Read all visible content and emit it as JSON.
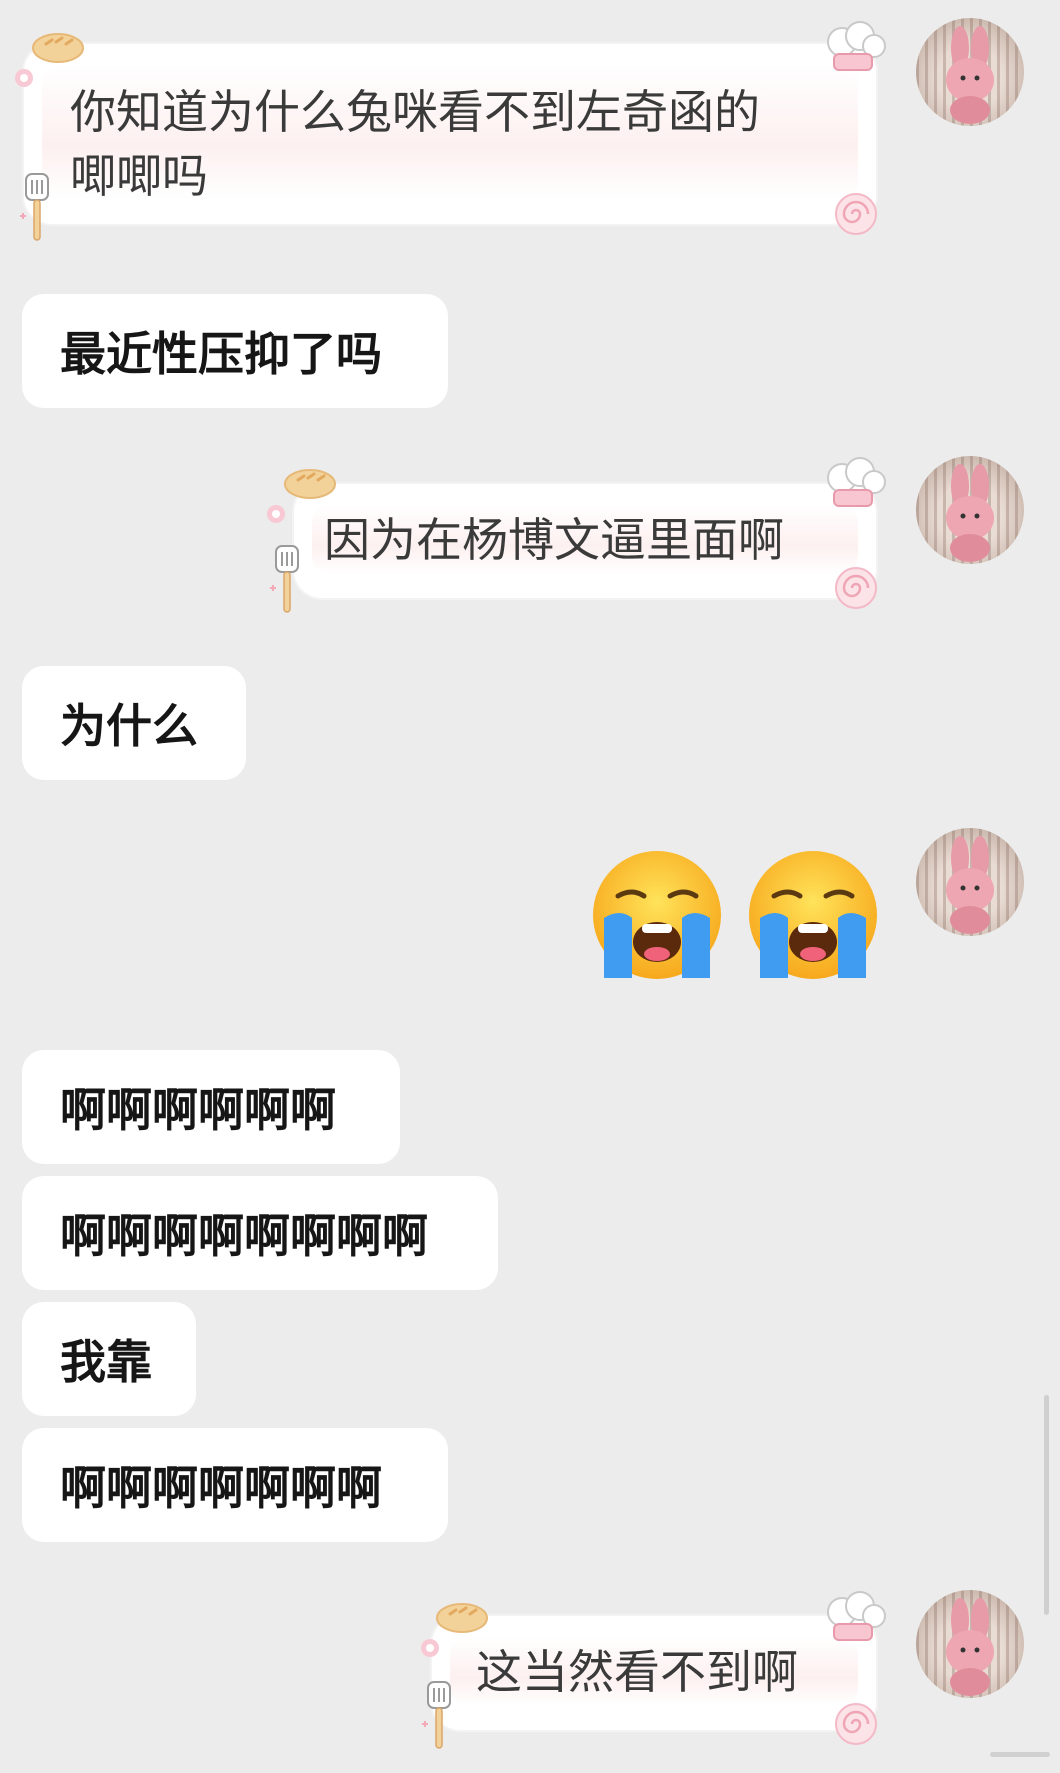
{
  "messages": [
    {
      "side": "right",
      "text_line1": "你知道为什么兔咪看不到左奇函的",
      "text_line2": "唧唧吗"
    },
    {
      "side": "left",
      "text": "最近性压抑了吗"
    },
    {
      "side": "right",
      "text": "因为在杨博文逼里面啊"
    },
    {
      "side": "left",
      "text": "为什么"
    },
    {
      "side": "right",
      "emoji": [
        "😭",
        "😭"
      ],
      "emoji_name": "loudly-crying-face"
    },
    {
      "side": "left",
      "text": "啊啊啊啊啊啊"
    },
    {
      "side": "left",
      "text": "啊啊啊啊啊啊啊啊"
    },
    {
      "side": "left",
      "text": "我靠"
    },
    {
      "side": "left",
      "text": "啊啊啊啊啊啊啊"
    },
    {
      "side": "right",
      "text": "这当然看不到啊"
    }
  ],
  "colors": {
    "background": "#ececec",
    "bubble": "#ffffff",
    "text": "#161616",
    "deco_pink": "#f6c9d2",
    "deco_bread": "#f3d29a"
  },
  "avatar": {
    "icon": "pink-bunny-plush-avatar"
  }
}
